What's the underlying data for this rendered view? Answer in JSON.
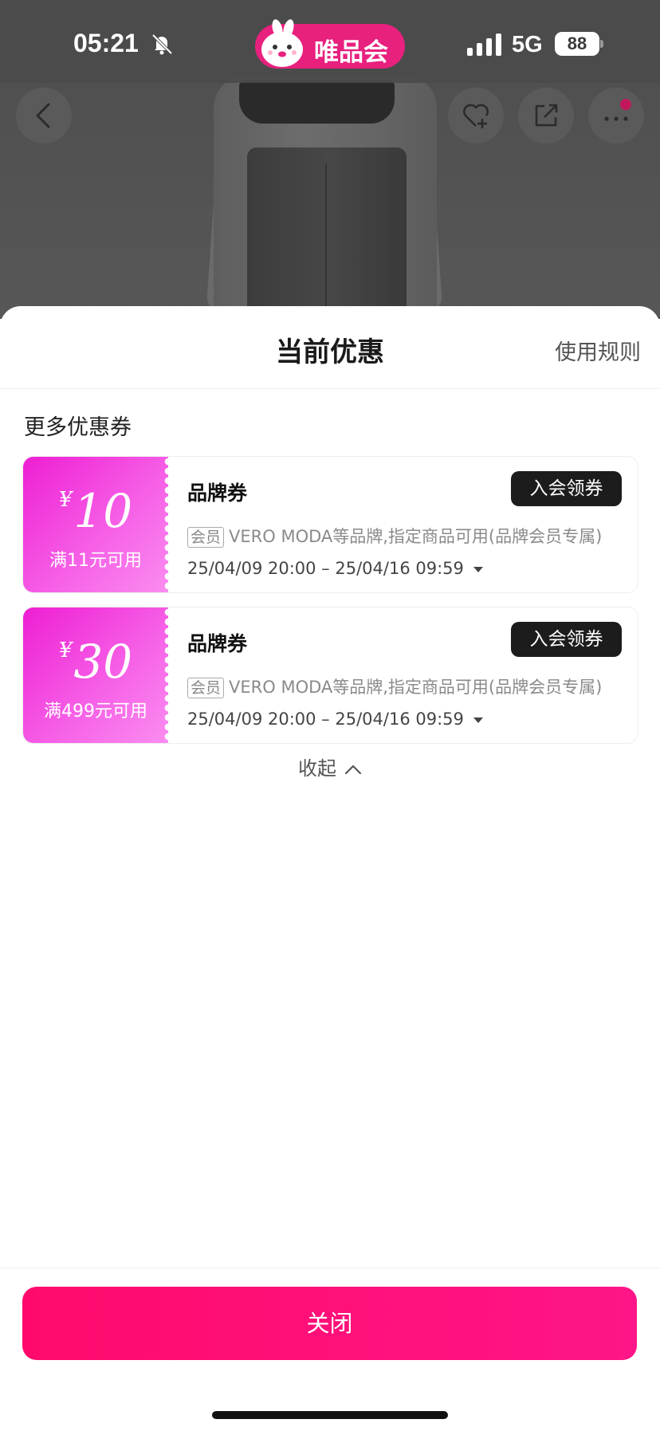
{
  "status_bar": {
    "time": "05:21",
    "network": "5G",
    "battery": "88",
    "app_badge": "唯品会"
  },
  "sheet": {
    "title": "当前优惠",
    "rules_link": "使用规则",
    "section_label": "更多优惠券",
    "coupons": [
      {
        "currency": "¥",
        "amount": "10",
        "threshold": "满11元可用",
        "type": "品牌券",
        "action": "入会领券",
        "member_tag": "会员",
        "scope": "VERO MODA等品牌,指定商品可用(品牌会员专属)",
        "validity": "25/04/09 20:00 – 25/04/16 09:59"
      },
      {
        "currency": "¥",
        "amount": "30",
        "threshold": "满499元可用",
        "type": "品牌券",
        "action": "入会领券",
        "member_tag": "会员",
        "scope": "VERO MODA等品牌,指定商品可用(品牌会员专属)",
        "validity": "25/04/09 20:00 – 25/04/16 09:59"
      }
    ],
    "collapse_label": "收起",
    "close_label": "关闭"
  },
  "colors": {
    "brand_pink": "#ff0a6c",
    "coupon_gradient_start": "#ee1ed3",
    "badge_dark": "#1c1c1c"
  }
}
